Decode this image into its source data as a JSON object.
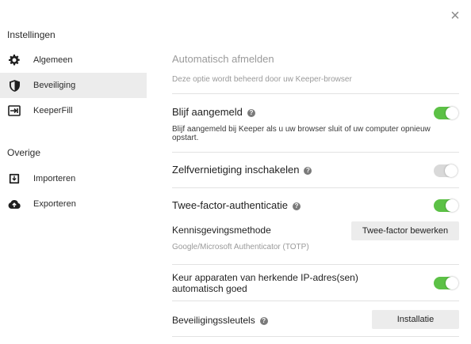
{
  "window": {
    "close_label": "×"
  },
  "sidebar": {
    "section1_title": "Instellingen",
    "items1": [
      {
        "label": "Algemeen",
        "icon": "gear-icon"
      },
      {
        "label": "Beveiliging",
        "icon": "shield-icon",
        "active": true
      },
      {
        "label": "KeeperFill",
        "icon": "keeperfill-icon"
      }
    ],
    "section2_title": "Overige",
    "items2": [
      {
        "label": "Importeren",
        "icon": "import-icon"
      },
      {
        "label": "Exporteren",
        "icon": "cloud-upload-icon"
      }
    ]
  },
  "settings": {
    "auto_logout": {
      "title": "Automatisch afmelden",
      "desc": "Deze optie wordt beheerd door uw Keeper-browser"
    },
    "stay_logged_in": {
      "title": "Blijf aangemeld",
      "desc": "Blijf aangemeld bij Keeper als u uw browser sluit of uw computer opnieuw opstart.",
      "enabled": true
    },
    "self_destruct": {
      "title": "Zelfvernietiging inschakelen",
      "enabled": false
    },
    "two_factor": {
      "title": "Twee-factor-authenticatie",
      "enabled": true,
      "method_label": "Kennisgevingsmethode",
      "method_value": "Google/Microsoft Authenticator (TOTP)",
      "edit_button": "Twee-factor bewerken"
    },
    "trusted_ip": {
      "title": "Keur apparaten van herkende IP-adres(sen) automatisch goed",
      "enabled": true
    },
    "security_keys": {
      "title": "Beveiligingssleutels",
      "button": "Installatie"
    }
  },
  "colors": {
    "toggle_on": "#5cc146",
    "toggle_off": "#d9d9d9",
    "active_nav_bg": "#ececec"
  }
}
